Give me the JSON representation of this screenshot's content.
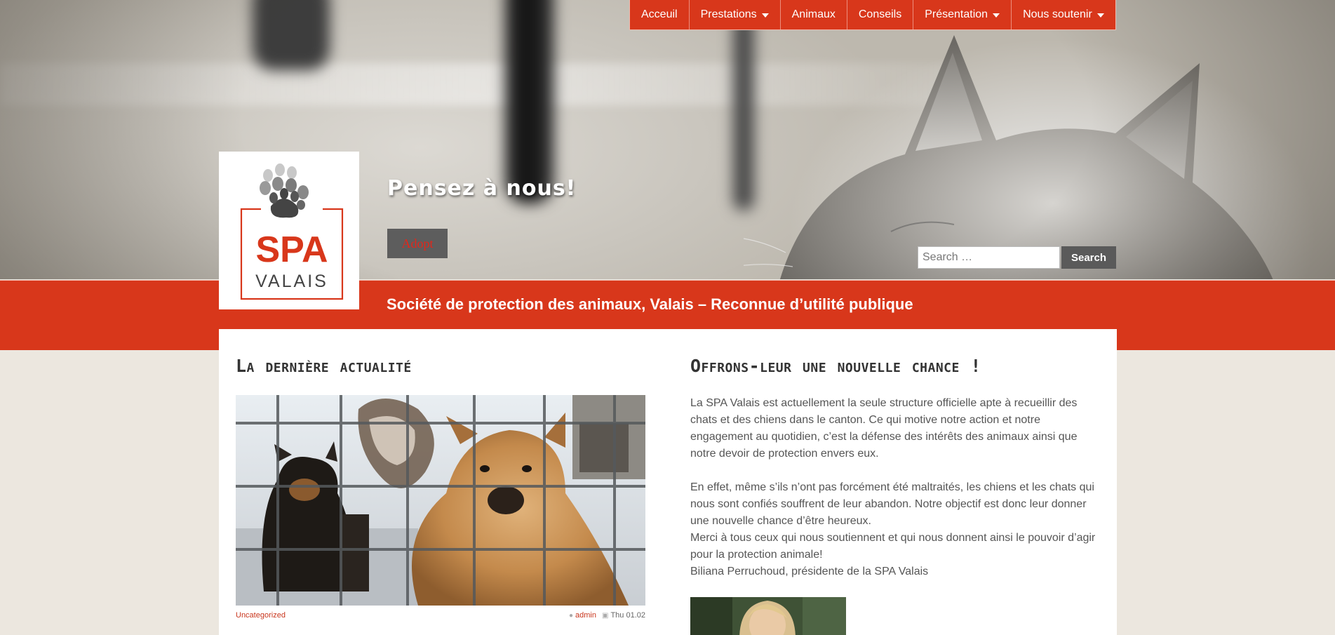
{
  "nav": {
    "items": [
      {
        "label": "Acceuil",
        "dropdown": false
      },
      {
        "label": "Prestations",
        "dropdown": true
      },
      {
        "label": "Animaux",
        "dropdown": false
      },
      {
        "label": "Conseils",
        "dropdown": false
      },
      {
        "label": "Présentation",
        "dropdown": true
      },
      {
        "label": "Nous soutenir",
        "dropdown": true
      }
    ]
  },
  "logo": {
    "name": "SPA",
    "region": "VALAIS"
  },
  "hero": {
    "tagline": "Pensez à nous!",
    "adopt_label": "Adopt"
  },
  "search": {
    "placeholder": "Search …",
    "button_label": "Search"
  },
  "site": {
    "description": "Société de protection des animaux, Valais – Reconnue d’utilité publique"
  },
  "news": {
    "title": "La dernière actualité",
    "category": "Uncategorized",
    "author": "admin",
    "date": "Thu 01.02"
  },
  "intro": {
    "title": "Offrons-leur une nouvelle chance !",
    "paragraph1": "La SPA Valais est actuellement la seule structure officielle apte à recueillir des chats et des chiens dans le canton. Ce qui motive notre action et notre engagement au quotidien, c’est la défense des intérêts des animaux ainsi que notre devoir de protection envers eux.",
    "paragraph2": "En effet, même s’ils n’ont pas  forcément été maltraités, les chiens et les chats qui nous sont confiés souffrent de leur abandon. Notre objectif est donc leur donner une nouvelle chance d’être heureux.",
    "paragraph3": "Merci à tous ceux qui nous soutiennent et qui nous donnent ainsi le pouvoir d’agir pour la protection animale!",
    "signature": "Biliana Perruchoud, présidente de la SPA Valais"
  },
  "colors": {
    "brand_red": "#d8371b",
    "button_gray": "#5a5a5a",
    "page_bg": "#ece7df"
  },
  "icons": [
    "user-icon",
    "calendar-icon",
    "caret-down-icon",
    "paw-icon"
  ]
}
